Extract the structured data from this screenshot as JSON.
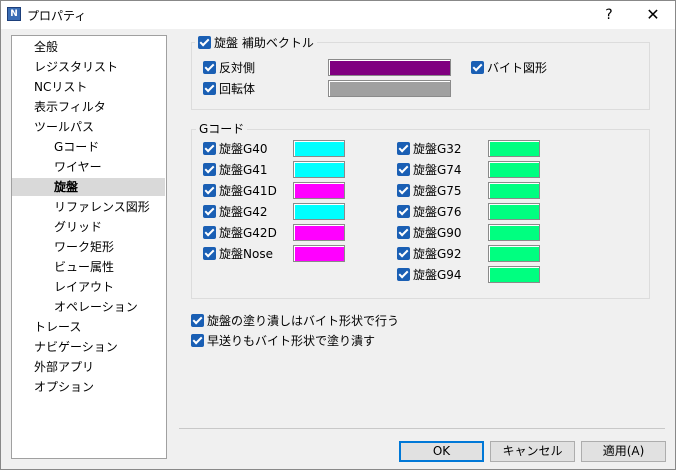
{
  "window": {
    "title": "プロパティ",
    "help": "?",
    "close": "✕",
    "app_icon": "N"
  },
  "tree": [
    {
      "label": "全般",
      "level": 0,
      "selected": false
    },
    {
      "label": "レジスタリスト",
      "level": 0,
      "selected": false
    },
    {
      "label": "NCリスト",
      "level": 0,
      "selected": false
    },
    {
      "label": "表示フィルタ",
      "level": 0,
      "selected": false
    },
    {
      "label": "ツールパス",
      "level": 0,
      "selected": false
    },
    {
      "label": "Gコード",
      "level": 1,
      "selected": false
    },
    {
      "label": "ワイヤー",
      "level": 1,
      "selected": false
    },
    {
      "label": "旋盤",
      "level": 1,
      "selected": true
    },
    {
      "label": "リファレンス図形",
      "level": 1,
      "selected": false
    },
    {
      "label": "グリッド",
      "level": 1,
      "selected": false
    },
    {
      "label": "ワーク矩形",
      "level": 1,
      "selected": false
    },
    {
      "label": "ビュー属性",
      "level": 1,
      "selected": false
    },
    {
      "label": "レイアウト",
      "level": 1,
      "selected": false
    },
    {
      "label": "オペレーション",
      "level": 1,
      "selected": false
    },
    {
      "label": "トレース",
      "level": 0,
      "selected": false
    },
    {
      "label": "ナビゲーション",
      "level": 0,
      "selected": false
    },
    {
      "label": "外部アプリ",
      "level": 0,
      "selected": false
    },
    {
      "label": "オプション",
      "level": 0,
      "selected": false
    }
  ],
  "aux_vector": {
    "title": "旋盤 補助ベクトル",
    "checked": true,
    "reverse": {
      "label": "反対側",
      "checked": true,
      "color": "#800080"
    },
    "rotation": {
      "label": "回転体",
      "checked": true,
      "color": "#a0a0a0"
    },
    "bite": {
      "label": "バイト図形",
      "checked": true
    }
  },
  "gcode": {
    "title": "Gコード",
    "left": [
      {
        "label": "旋盤G40",
        "checked": true,
        "color": "#00ffff"
      },
      {
        "label": "旋盤G41",
        "checked": true,
        "color": "#00ffff"
      },
      {
        "label": "旋盤G41D",
        "checked": true,
        "color": "#ff00ff"
      },
      {
        "label": "旋盤G42",
        "checked": true,
        "color": "#00ffff"
      },
      {
        "label": "旋盤G42D",
        "checked": true,
        "color": "#ff00ff"
      },
      {
        "label": "旋盤Nose",
        "checked": true,
        "color": "#ff00ff"
      }
    ],
    "right": [
      {
        "label": "旋盤G32",
        "checked": true,
        "color": "#00ff80"
      },
      {
        "label": "旋盤G74",
        "checked": true,
        "color": "#00ff80"
      },
      {
        "label": "旋盤G75",
        "checked": true,
        "color": "#00ff80"
      },
      {
        "label": "旋盤G76",
        "checked": true,
        "color": "#00ff80"
      },
      {
        "label": "旋盤G90",
        "checked": true,
        "color": "#00ff80"
      },
      {
        "label": "旋盤G92",
        "checked": true,
        "color": "#00ff80"
      },
      {
        "label": "旋盤G94",
        "checked": true,
        "color": "#00ff80"
      }
    ]
  },
  "options": [
    {
      "label": "旋盤の塗り潰しはバイト形状で行う",
      "checked": true
    },
    {
      "label": "早送りもバイト形状で塗り潰す",
      "checked": true
    }
  ],
  "buttons": {
    "ok": "OK",
    "cancel": "キャンセル",
    "apply": "適用(A)"
  }
}
